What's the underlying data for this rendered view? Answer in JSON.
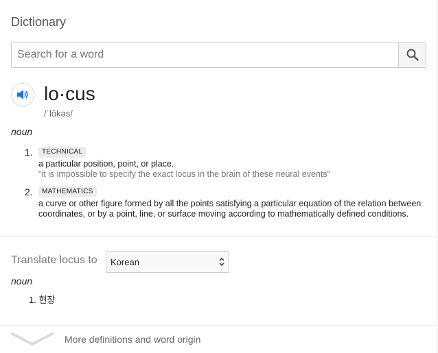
{
  "header": {
    "title": "Dictionary"
  },
  "search": {
    "placeholder": "Search for a word",
    "value": ""
  },
  "entry": {
    "word": "lo·cus",
    "phonetic": "/ˈlōkəs/",
    "part_of_speech": "noun",
    "senses": [
      {
        "number": "1.",
        "label": "TECHNICAL",
        "definition": "a particular position, point, or place.",
        "example": "\"it is impossible to specify the exact locus in the brain of these neural events\""
      },
      {
        "number": "2.",
        "label": "MATHEMATICS",
        "definition": "a curve or other figure formed by all the points satisfying a particular equation of the relation between coordinates, or by a point, line, or surface moving according to mathematically defined conditions."
      }
    ]
  },
  "translate": {
    "label": "Translate locus to",
    "selected_language": "Korean",
    "part_of_speech": "noun",
    "items": [
      {
        "number": "1.",
        "text": "현장"
      }
    ]
  },
  "footer": {
    "more_label": "More definitions and word origin"
  },
  "colors": {
    "accent": "#1a73e8",
    "muted": "#777777",
    "badge_bg": "#ececec"
  },
  "icons": {
    "search": "search-icon",
    "speaker": "speaker-icon",
    "chevron": "chevron-down-icon"
  }
}
